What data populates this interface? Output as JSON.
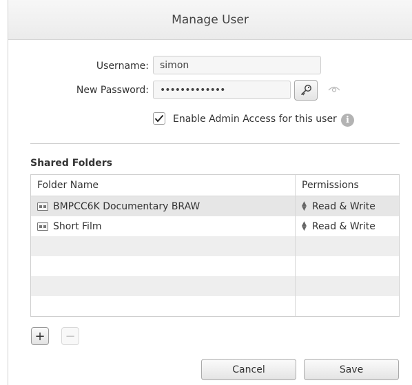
{
  "dialog": {
    "title": "Manage User"
  },
  "form": {
    "username_label": "Username:",
    "username_value": "simon",
    "password_label": "New Password:",
    "password_value": "•••••••••••••",
    "admin_checkbox_label": "Enable Admin Access for this user",
    "admin_checked": true
  },
  "shared_folders": {
    "title": "Shared Folders",
    "columns": [
      "Folder Name",
      "Permissions"
    ],
    "rows": [
      {
        "name": "BMPCC6K Documentary BRAW",
        "permission": "Read & Write"
      },
      {
        "name": "Short Film",
        "permission": "Read & Write"
      }
    ]
  },
  "buttons": {
    "add": "+",
    "remove": "−",
    "cancel": "Cancel",
    "save": "Save"
  },
  "icons": {
    "key": "key-icon",
    "reveal": "eye-icon",
    "info": "info-icon",
    "folder": "folder-icon"
  }
}
